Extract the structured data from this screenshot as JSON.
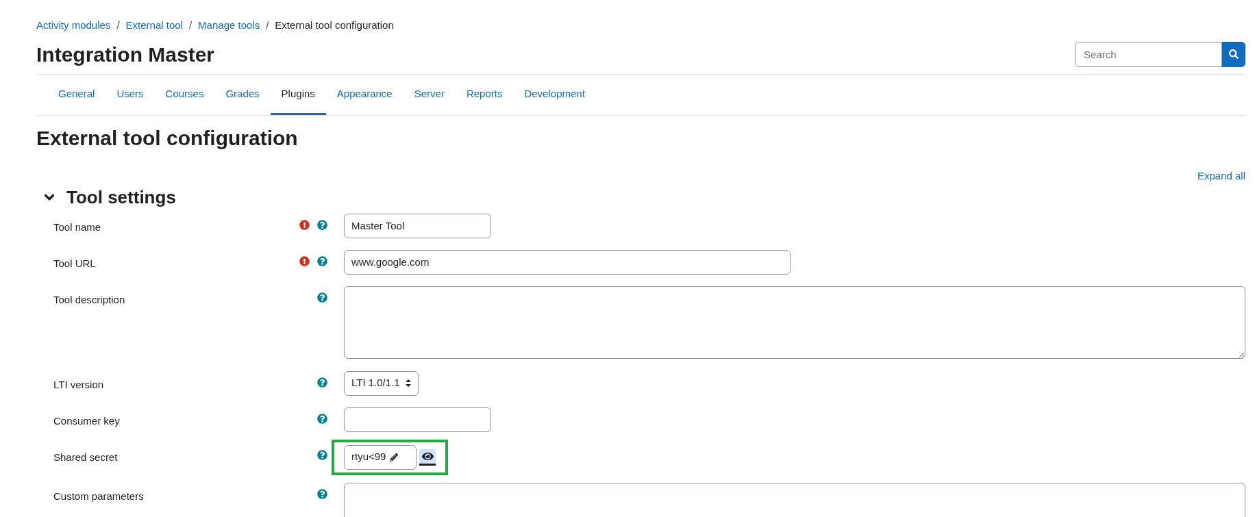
{
  "breadcrumb": [
    {
      "label": "Activity modules",
      "link": true
    },
    {
      "label": "External tool",
      "link": true
    },
    {
      "label": "Manage tools",
      "link": true
    },
    {
      "label": "External tool configuration",
      "link": false
    }
  ],
  "separator": "/",
  "site_title": "Integration Master",
  "search": {
    "placeholder": "Search"
  },
  "tabs": [
    {
      "label": "General",
      "selected": false
    },
    {
      "label": "Users",
      "selected": false
    },
    {
      "label": "Courses",
      "selected": false
    },
    {
      "label": "Grades",
      "selected": false
    },
    {
      "label": "Plugins",
      "selected": true
    },
    {
      "label": "Appearance",
      "selected": false
    },
    {
      "label": "Server",
      "selected": false
    },
    {
      "label": "Reports",
      "selected": false
    },
    {
      "label": "Development",
      "selected": false
    }
  ],
  "page_title": "External tool configuration",
  "expand_all": "Expand all",
  "section": {
    "title": "Tool settings",
    "expanded": true
  },
  "fields": [
    {
      "kind": "text",
      "label": "Tool name",
      "required": true,
      "value": "Master Tool"
    },
    {
      "kind": "url",
      "label": "Tool URL",
      "required": true,
      "value": "www.google.com"
    },
    {
      "kind": "textarea",
      "label": "Tool description",
      "required": false
    },
    {
      "kind": "select",
      "label": "LTI version",
      "required": false,
      "value": "LTI 1.0/1.1"
    },
    {
      "kind": "text",
      "label": "Consumer key",
      "required": false
    },
    {
      "kind": "secret",
      "label": "Shared secret",
      "required": false,
      "value": "rtyu<99",
      "highlighted": true
    },
    {
      "kind": "textarea",
      "label": "Custom parameters",
      "required": false
    }
  ]
}
